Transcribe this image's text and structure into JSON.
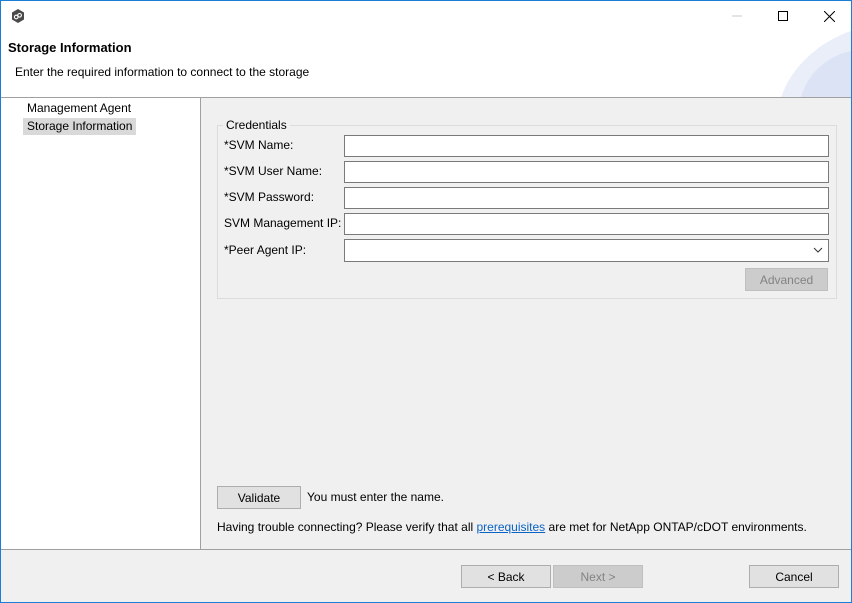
{
  "window": {
    "app_icon": "peer-software-hex-icon",
    "controls": {
      "minimize": "minimize-icon",
      "maximize": "maximize-icon",
      "close": "close-icon"
    }
  },
  "header": {
    "title": "Storage Information",
    "description": "Enter the required information to connect to the storage"
  },
  "nav": {
    "items": [
      {
        "label": "Management Agent",
        "selected": false
      },
      {
        "label": "Storage Information",
        "selected": true
      }
    ]
  },
  "credentials": {
    "legend": "Credentials",
    "fields": [
      {
        "label": "*SVM Name:",
        "value": "",
        "type": "text"
      },
      {
        "label": "*SVM User Name:",
        "value": "",
        "type": "text"
      },
      {
        "label": "*SVM Password:",
        "value": "",
        "type": "password"
      },
      {
        "label": "SVM Management IP:",
        "value": "",
        "type": "text"
      },
      {
        "label": "*Peer Agent IP:",
        "value": "",
        "type": "select"
      }
    ],
    "advanced_label": "Advanced"
  },
  "validation": {
    "button_label": "Validate",
    "message": "You must enter the name."
  },
  "help": {
    "before": "Having trouble connecting? Please verify that all ",
    "link": "prerequisites",
    "after": " are met for NetApp ONTAP/cDOT environments."
  },
  "footer": {
    "back_label": "< Back",
    "next_label": "Next >",
    "cancel_label": "Cancel"
  },
  "colors": {
    "accent_border": "#1a7fd4",
    "link": "#0b63c5"
  }
}
